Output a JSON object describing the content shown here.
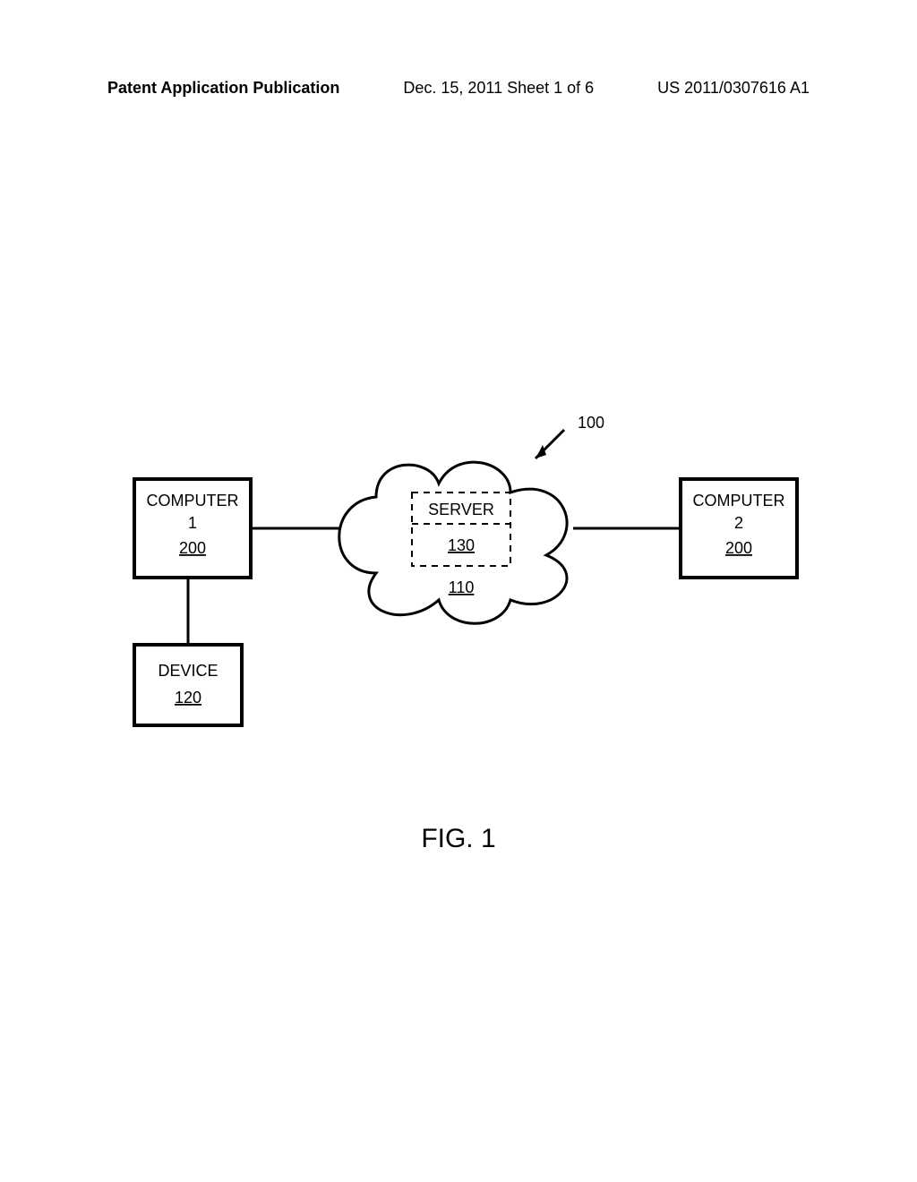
{
  "header": {
    "left": "Patent Application Publication",
    "center": "Dec. 15, 2011  Sheet 1 of 6",
    "right": "US 2011/0307616 A1"
  },
  "figure": {
    "label": "FIG. 1",
    "system_ref": "100",
    "computer1": {
      "title": "COMPUTER",
      "num": "1",
      "ref": "200"
    },
    "computer2": {
      "title": "COMPUTER",
      "num": "2",
      "ref": "200"
    },
    "device": {
      "title": "DEVICE",
      "ref": "120"
    },
    "server": {
      "title": "SERVER",
      "ref": "130"
    },
    "cloud_ref": "110"
  }
}
